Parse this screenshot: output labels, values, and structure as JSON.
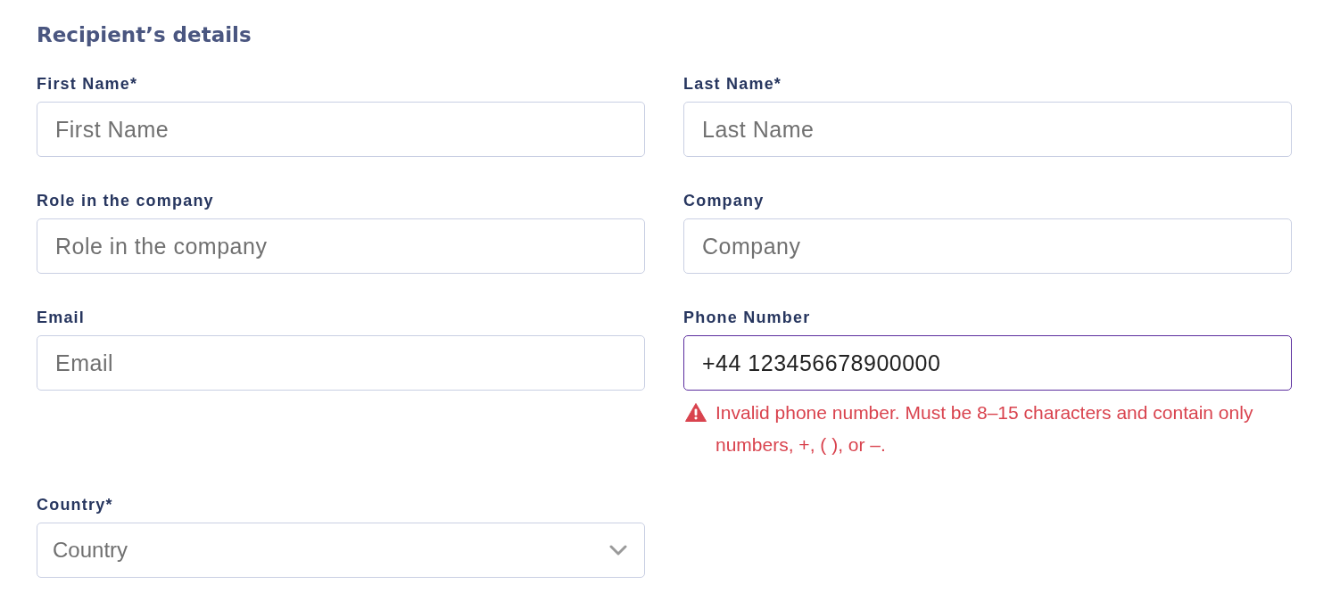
{
  "heading": "Recipient’s details",
  "fields": [
    {
      "label": "First Name*",
      "kind": "text",
      "placeholder": "First Name",
      "focused": false
    },
    {
      "label": "Last Name*",
      "kind": "text",
      "placeholder": "Last Name",
      "focused": false
    },
    {
      "label": "Role in the company",
      "kind": "text",
      "placeholder": "Role in the company",
      "focused": false
    },
    {
      "label": "Company",
      "kind": "text",
      "placeholder": "Company",
      "focused": false
    },
    {
      "label": "Email",
      "kind": "text",
      "placeholder": "Email",
      "focused": false
    },
    {
      "label": "Phone Number",
      "kind": "text",
      "value": "+44 123456678900000",
      "focused": true,
      "error": "Invalid phone number. Must be 8–15 characters and contain only numbers, +, ( ), or –."
    },
    {
      "label": "Country*",
      "kind": "select",
      "placeholder": "Country",
      "focused": false
    }
  ]
}
